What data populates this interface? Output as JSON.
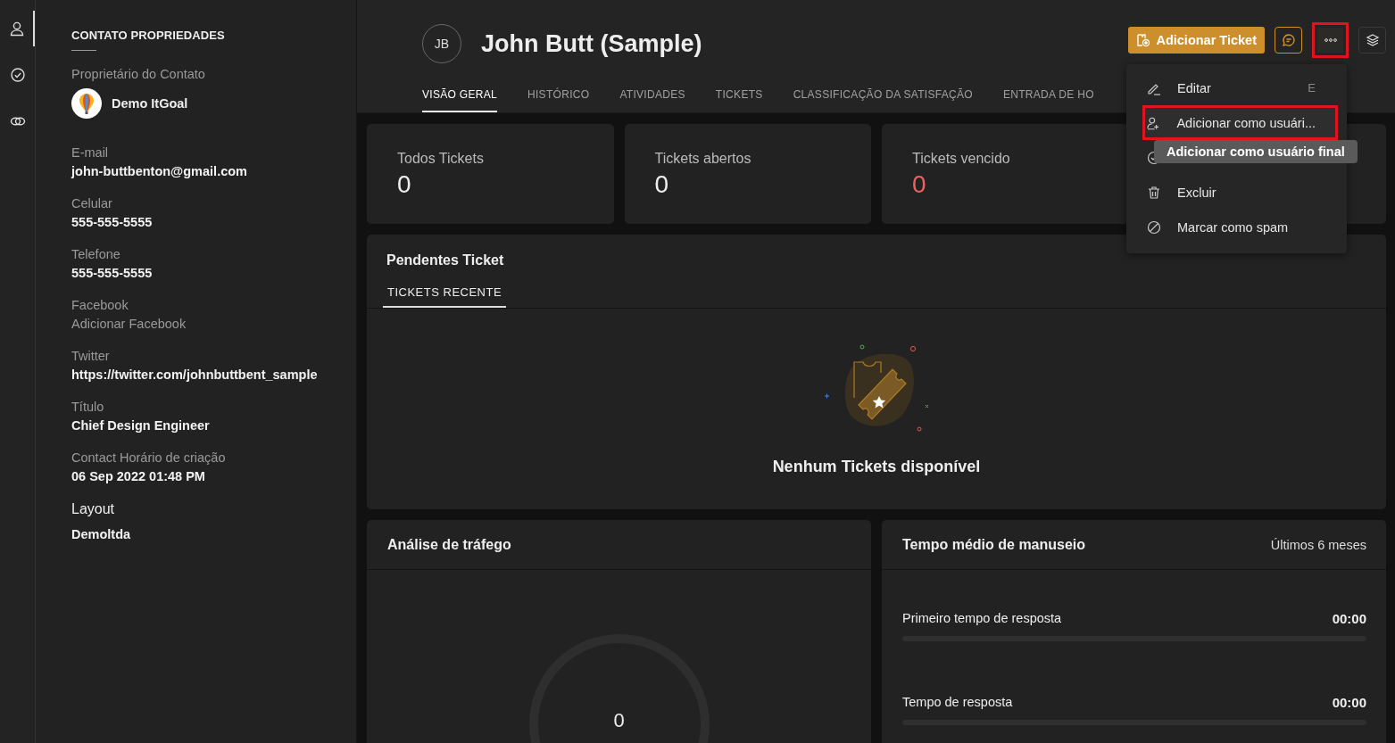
{
  "rail": [
    {
      "kind": "user",
      "selected": true
    },
    {
      "kind": "check",
      "selected": false
    },
    {
      "kind": "link",
      "selected": false
    }
  ],
  "properties": {
    "title": "CONTATO PROPRIEDADES",
    "fields": [
      {
        "kind": "owner",
        "label": "Proprietário do Contato",
        "value": "Demo ItGoal"
      },
      {
        "kind": "text",
        "label": "E-mail",
        "value": "john-buttbenton@gmail.com"
      },
      {
        "kind": "text",
        "label": "Celular",
        "value": "555-555-5555"
      },
      {
        "kind": "text",
        "label": "Telefone",
        "value": "555-555-5555"
      },
      {
        "kind": "empty",
        "label": "Facebook",
        "value": "Adicionar Facebook"
      },
      {
        "kind": "text",
        "label": "Twitter",
        "value": "https://twitter.com/johnbuttbent_sample"
      },
      {
        "kind": "text",
        "label": "Título",
        "value": "Chief Design Engineer"
      },
      {
        "kind": "text",
        "label": "Contact Horário de criação",
        "value": "06 Sep 2022 01:48 PM"
      },
      {
        "kind": "layout",
        "label": "Layout",
        "value": "Demoltda"
      }
    ]
  },
  "contact": {
    "initials": "JB",
    "name": "John Butt (Sample)"
  },
  "actions": {
    "add_ticket": "Adicionar Ticket",
    "more_highlighted": true
  },
  "tabs": [
    {
      "label": "VISÃO GERAL",
      "selected": true
    },
    {
      "label": "HISTÓRICO",
      "selected": false
    },
    {
      "label": "ATIVIDADES",
      "selected": false
    },
    {
      "label": "TICKETS",
      "selected": false
    },
    {
      "label": "CLASSIFICAÇÃO DA SATISFAÇÃO",
      "selected": false
    },
    {
      "label": "ENTRADA DE HO",
      "selected": false
    }
  ],
  "stats": [
    {
      "label": "Todos Tickets",
      "value": "0",
      "alert": false
    },
    {
      "label": "Tickets abertos",
      "value": "0",
      "alert": false
    },
    {
      "label": "Tickets vencido",
      "value": "0",
      "alert": true
    }
  ],
  "pending": {
    "title": "Pendentes Ticket",
    "tab": "TICKETS RECENTE",
    "empty_text": "Nenhum Tickets disponível"
  },
  "traffic": {
    "title": "Análise de tráfego",
    "center_value": "0"
  },
  "handling": {
    "title": "Tempo médio de manuseio",
    "period": "Últimos 6 meses",
    "metrics": [
      {
        "label": "Primeiro tempo de resposta",
        "value": "00:00",
        "level": 0
      },
      {
        "label": "Tempo de resposta",
        "value": "00:00",
        "level": 0
      }
    ]
  },
  "menu": {
    "items": [
      {
        "kind": "edit",
        "label": "Editar",
        "shortcut": "E",
        "highlighted": false
      },
      {
        "kind": "add-user",
        "label": "Adicionar como usuári...",
        "highlighted": true
      },
      {
        "kind": "check",
        "highlighted": false
      },
      {
        "kind": "delete",
        "label": "Excluir",
        "highlighted": false
      },
      {
        "kind": "spam",
        "label": "Marcar como spam",
        "highlighted": false
      }
    ]
  },
  "tooltip": "Adicionar como usuário final"
}
